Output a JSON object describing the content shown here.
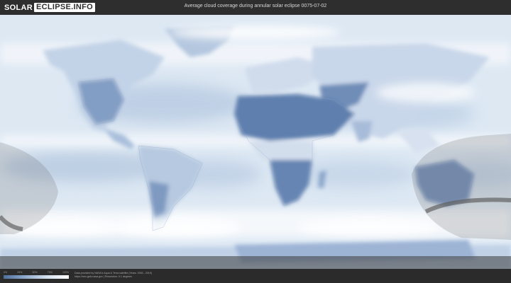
{
  "header": {
    "logo_left": "SOLAR",
    "logo_right": "ECLIPSE.INFO",
    "title": "Average cloud coverage during annular solar eclipse 0075-07-02"
  },
  "legend": {
    "ticks": [
      "0%",
      "25%",
      "50%",
      "75%",
      "100%"
    ],
    "color_low": "#4e6f9e",
    "color_high": "#ffffff"
  },
  "footer": {
    "credit_line1": "Data provided by NASA's Aqua & Terra satellite (Years: 2000 - 2019)",
    "credit_line2": "https://neo.gsfc.nasa.gov | Resolution: 0.1 degrees"
  },
  "colors": {
    "ocean_haze": "#dbe6f2",
    "clear_land": "#6f8db8",
    "cloud": "#ffffff",
    "eclipse_path": "#5a5a5a"
  }
}
